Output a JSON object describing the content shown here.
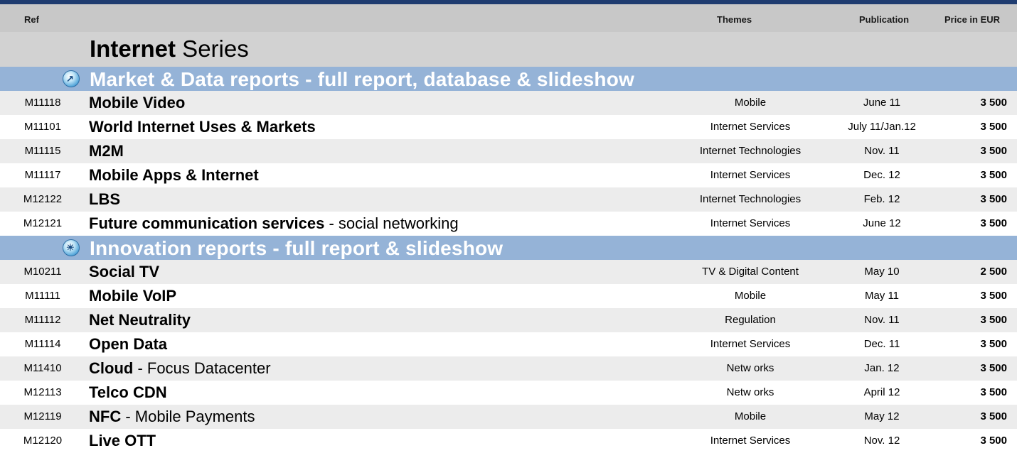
{
  "header": {
    "ref": "Ref",
    "themes": "Themes",
    "publication": "Publication",
    "price": "Price in EUR"
  },
  "series": {
    "bold": "Internet",
    "rest": " Series"
  },
  "sections": [
    {
      "title": "Market & Data reports - full report, database & slideshow",
      "icon": "chart-globe-icon",
      "rows": [
        {
          "ref": "M11118",
          "title": "Mobile Video",
          "suffix": "",
          "theme": "Mobile",
          "pub": "June 11",
          "price": "3 500"
        },
        {
          "ref": "M11101",
          "title": "World Internet Uses & Markets",
          "suffix": "",
          "theme": "Internet Services",
          "pub": "July 11/Jan.12",
          "price": "3 500"
        },
        {
          "ref": "M11115",
          "title": "M2M",
          "suffix": "",
          "theme": "Internet Technologies",
          "pub": "Nov. 11",
          "price": "3 500"
        },
        {
          "ref": "M11117",
          "title": "Mobile Apps & Internet",
          "suffix": "",
          "theme": "Internet Services",
          "pub": "Dec. 12",
          "price": "3 500"
        },
        {
          "ref": "M12122",
          "title": "LBS",
          "suffix": "",
          "theme": "Internet Technologies",
          "pub": "Feb. 12",
          "price": "3 500"
        },
        {
          "ref": "M12121",
          "title": "Future communication services",
          "suffix": " - social networking",
          "theme": "Internet Services",
          "pub": "June 12",
          "price": "3 500"
        }
      ]
    },
    {
      "title": "Innovation reports - full report & slideshow",
      "icon": "lightbulb-icon",
      "rows": [
        {
          "ref": "M10211",
          "title": "Social TV",
          "suffix": "",
          "theme": "TV & Digital Content",
          "pub": "May 10",
          "price": "2 500"
        },
        {
          "ref": "M11111",
          "title": "Mobile VoIP",
          "suffix": "",
          "theme": "Mobile",
          "pub": "May 11",
          "price": "3 500"
        },
        {
          "ref": "M11112",
          "title": "Net Neutrality",
          "suffix": "",
          "theme": "Regulation",
          "pub": "Nov. 11",
          "price": "3 500"
        },
        {
          "ref": "M11114",
          "title": "Open Data",
          "suffix": "",
          "theme": "Internet Services",
          "pub": "Dec. 11",
          "price": "3 500"
        },
        {
          "ref": "M11410",
          "title": "Cloud",
          "suffix": " - Focus Datacenter",
          "theme": "Netw orks",
          "pub": "Jan. 12",
          "price": "3 500"
        },
        {
          "ref": "M12113",
          "title": "Telco CDN",
          "suffix": "",
          "theme": "Netw orks",
          "pub": "April 12",
          "price": "3 500"
        },
        {
          "ref": "M12119",
          "title": "NFC",
          "suffix": " - Mobile Payments",
          "theme": "Mobile",
          "pub": "May 12",
          "price": "3 500"
        },
        {
          "ref": "M12120",
          "title": "Live OTT",
          "suffix": "",
          "theme": "Internet Services",
          "pub": "Nov. 12",
          "price": "3 500"
        }
      ]
    }
  ]
}
